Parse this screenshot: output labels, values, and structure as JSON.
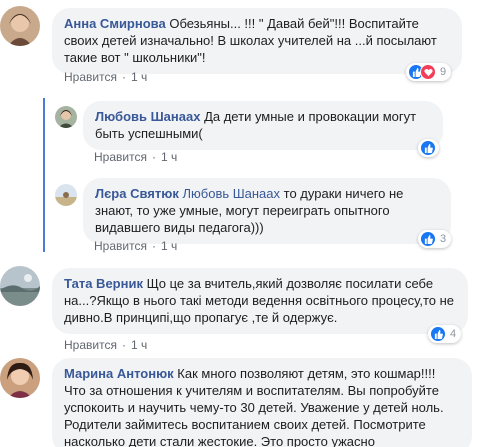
{
  "comments": [
    {
      "author": "Анна Смирнова",
      "text": " Обезьяны... !!! \" Давай бей\"!!! Воспитайте своих детей изначально! В школах учителей на ...й посылают такие вот \" школьники\"!",
      "like_label": "Нравится",
      "time": "1 ч",
      "reaction_count": "9",
      "reactions": [
        "like-icon",
        "heart-icon"
      ]
    },
    {
      "author": "Любовь Шанаах",
      "text": " Да дети умные и провокации могут быть успешными(",
      "like_label": "Нравится",
      "time": "1 ч",
      "reactions": [
        "like-icon"
      ]
    },
    {
      "author": "Лєра Святюк",
      "mention": "Любовь Шанаах",
      "text": " то дураки ничего не знают, то уже умные, могут переиграть опытного видавшего виды педагога)))",
      "like_label": "Нравится",
      "time": "1 ч",
      "reaction_count": "3",
      "reactions": [
        "like-icon"
      ]
    },
    {
      "author": "Тата Верник",
      "text": " Що це за вчитель,який дозволяє посилати себе на...?Якщо в нього такі методи ведення освітнього процесу,то не дивно.В принципі,що пропагує ,те й одержує.",
      "like_label": "Нравится",
      "time": "1 ч",
      "reaction_count": "4",
      "reactions": [
        "like-icon"
      ]
    },
    {
      "author": "Марина Антонюк",
      "text": " Как много позволяют детям, это кошмар!!!! Что за отношения к учителям и воспитателям. Вы попробуйте успокоить и научить чему-то 30 детей. Уважение у детей ноль. Родители займитесь воспитанием своих детей. Посмотрите насколько дети стали жестокие. Это просто ужасно"
    }
  ],
  "colors": {
    "link": "#385898",
    "bubble": "#f2f3f5",
    "like": "#1877f2",
    "heart": "#f33e58",
    "thread": "#4b7bd9"
  }
}
